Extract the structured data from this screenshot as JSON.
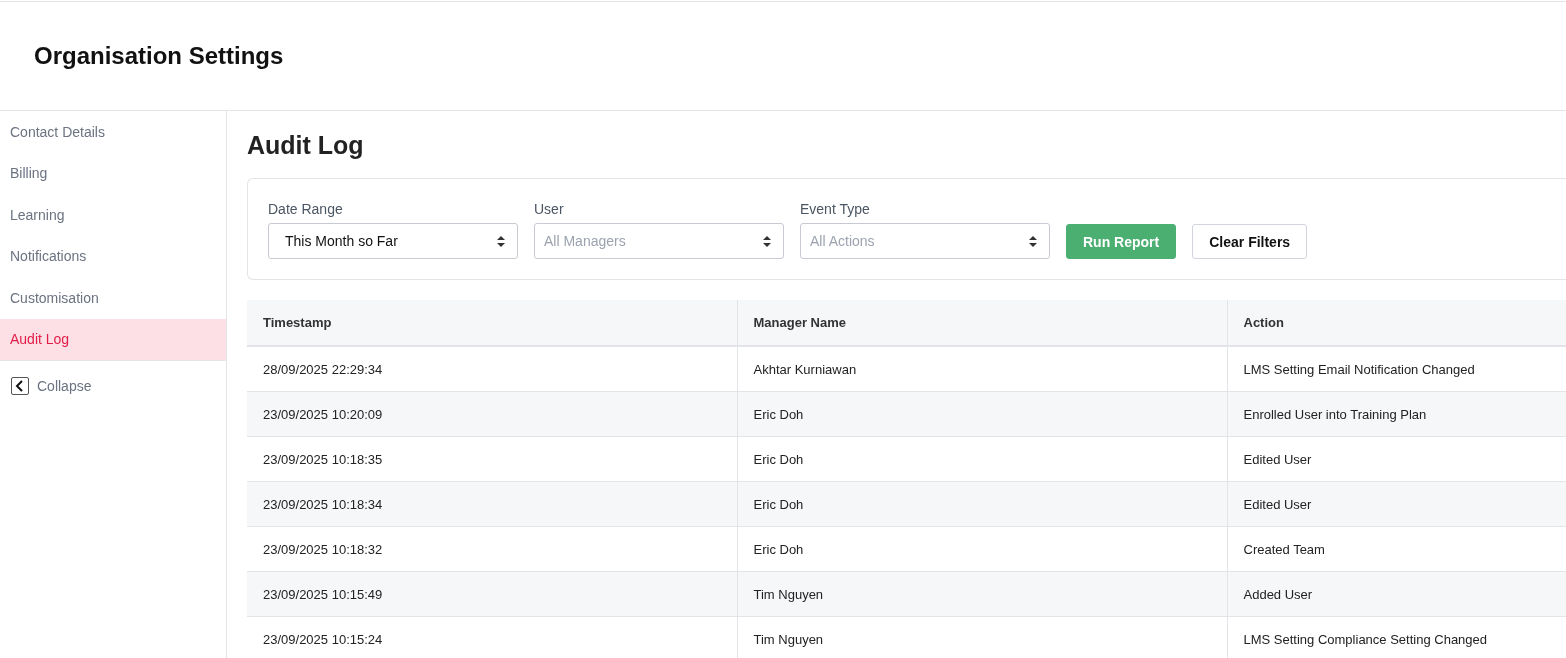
{
  "header": {
    "title": "Organisation Settings"
  },
  "sidebar": {
    "items": [
      {
        "label": "Contact Details",
        "selected": false
      },
      {
        "label": "Billing",
        "selected": false
      },
      {
        "label": "Learning",
        "selected": false
      },
      {
        "label": "Notifications",
        "selected": false
      },
      {
        "label": "Customisation",
        "selected": false
      },
      {
        "label": "Audit Log",
        "selected": true
      }
    ],
    "collapse": {
      "label": "Collapse"
    }
  },
  "page_title": "Audit Log",
  "filters": [
    {
      "label": "Date Range",
      "value": "This Month so Far"
    },
    {
      "label": "User",
      "placeholder": "All Managers"
    },
    {
      "label": "Event Type",
      "placeholder": "All Actions"
    }
  ],
  "buttons": [
    {
      "label": "Run Report",
      "kind": "primary"
    },
    {
      "label": "Clear Filters",
      "kind": "secondary"
    }
  ],
  "table": {
    "columns": [
      "Timestamp",
      "Manager Name",
      "Action"
    ],
    "rows": [
      [
        "28/09/2025 22:29:34",
        "Akhtar Kurniawan",
        "LMS Setting Email Notification Changed"
      ],
      [
        "23/09/2025 10:20:09",
        "Eric Doh",
        "Enrolled User into Training Plan"
      ],
      [
        "23/09/2025 10:18:35",
        "Eric Doh",
        "Edited User"
      ],
      [
        "23/09/2025 10:18:34",
        "Eric Doh",
        "Edited User"
      ],
      [
        "23/09/2025 10:18:32",
        "Eric Doh",
        "Created Team"
      ],
      [
        "23/09/2025 10:15:49",
        "Tim Nguyen",
        "Added User"
      ],
      [
        "23/09/2025 10:15:24",
        "Tim Nguyen",
        "LMS Setting Compliance Setting Changed"
      ]
    ]
  }
}
